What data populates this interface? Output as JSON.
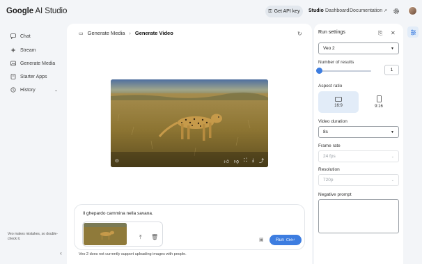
{
  "header": {
    "logo_google": "Google",
    "logo_product": "AI Studio",
    "api_button": "Get API key",
    "nav": [
      "Studio",
      "Dashboard",
      "Documentation"
    ]
  },
  "sidebar": {
    "items": [
      {
        "label": "Chat",
        "icon": "chat-icon"
      },
      {
        "label": "Stream",
        "icon": "stream-icon"
      },
      {
        "label": "Generate Media",
        "icon": "media-icon"
      },
      {
        "label": "Starter Apps",
        "icon": "apps-icon"
      },
      {
        "label": "History",
        "icon": "history-icon"
      }
    ],
    "note": "Veo makes mistakes, so double-check it."
  },
  "main": {
    "breadcrumb": [
      "Generate Media",
      "Generate Video"
    ],
    "prompt_text": "Il ghepardo cammina nella savana.",
    "run_label": "Run",
    "run_shortcut": "Ctrl↵",
    "disclaimer": "Veo 2 does not currently support uploading images with people."
  },
  "run_settings": {
    "title": "Run settings",
    "model": "Veo 2",
    "number_of_results_label": "Number of results",
    "number_of_results": "1",
    "slider_fraction": 0.0,
    "aspect_ratio_label": "Aspect ratio",
    "aspect_options": [
      "16:9",
      "9:16"
    ],
    "aspect_selected": "16:9",
    "video_duration_label": "Video duration",
    "video_duration": "8s",
    "frame_rate_label": "Frame rate",
    "frame_rate": "24 fps",
    "resolution_label": "Resolution",
    "resolution": "720p",
    "negative_prompt_label": "Negative prompt"
  },
  "colors": {
    "accent": "#3d7de0",
    "selected_bg": "#e2ecf8",
    "page_bg": "#f3f5f8"
  }
}
